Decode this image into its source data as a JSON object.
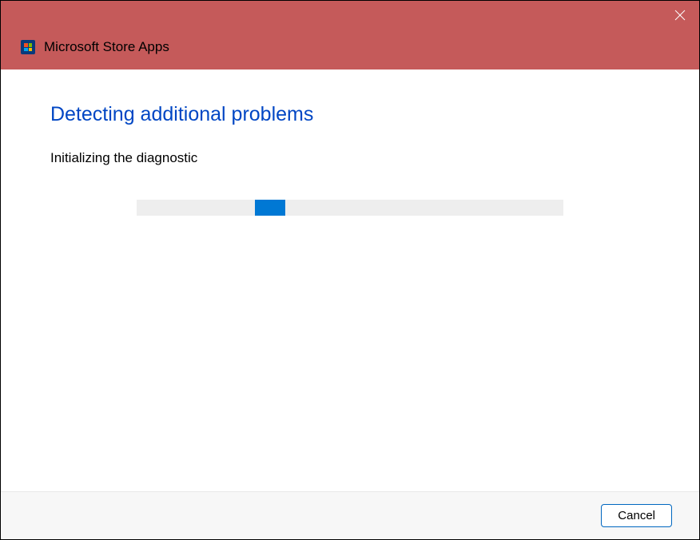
{
  "titlebar": {
    "app_title": "Microsoft Store Apps"
  },
  "content": {
    "heading": "Detecting additional problems",
    "status": "Initializing the diagnostic"
  },
  "footer": {
    "cancel_label": "Cancel"
  },
  "colors": {
    "titlebar_bg": "#c55a5a",
    "heading_color": "#0046c4",
    "progress_accent": "#0078d4"
  }
}
